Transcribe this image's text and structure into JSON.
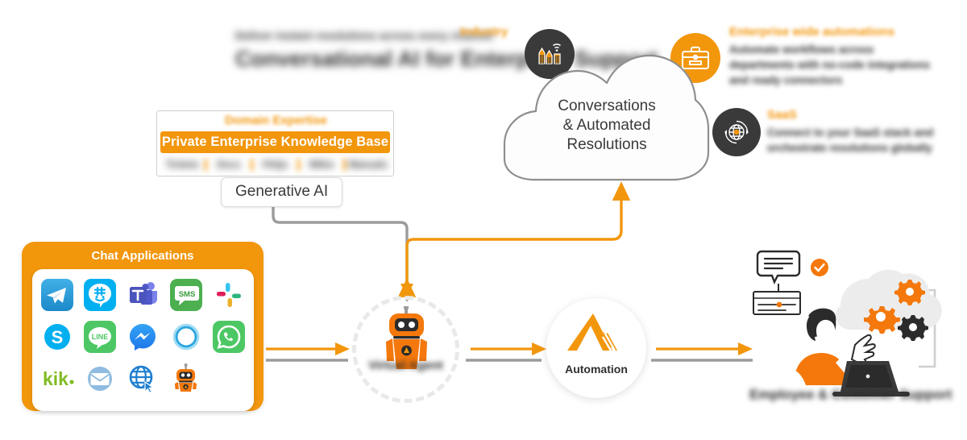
{
  "top_heading": {
    "subtitle": "Deliver instant resolutions across every channel",
    "title": "Conversational AI for Enterprise Support"
  },
  "industry": {
    "label": "Industry",
    "icon": "city-wifi-icon"
  },
  "enterprise": {
    "label": "Enterprise wide automations",
    "body": "Automate workflows across departments with no-code integrations and ready connectors",
    "icon": "briefcase-icon"
  },
  "saas": {
    "label": "SaaS",
    "body": "Connect to your SaaS stack and orchestrate resolutions globally",
    "icon": "globe-gear-icon"
  },
  "knowledge_base": {
    "domain_title": "Domain Expertise",
    "bar_label": "Private Enterprise Knowledge Base",
    "sources": [
      "Tickets",
      "Docs",
      "FAQs",
      "Wikis",
      "Manuals"
    ],
    "gen_ai_label": "Generative AI"
  },
  "cloud": {
    "line1": "Conversations",
    "line2": "& Automated",
    "line3": "Resolutions"
  },
  "chat_applications": {
    "title": "Chat Applications",
    "apps": [
      {
        "name": "telegram-icon",
        "label": "Telegram"
      },
      {
        "name": "groupme-icon",
        "label": "GroupMe"
      },
      {
        "name": "microsoft-teams-icon",
        "label": "Microsoft Teams"
      },
      {
        "name": "sms-icon",
        "label": "SMS"
      },
      {
        "name": "slack-icon",
        "label": "Slack"
      },
      {
        "name": "skype-icon",
        "label": "Skype"
      },
      {
        "name": "line-icon",
        "label": "LINE"
      },
      {
        "name": "facebook-messenger-icon",
        "label": "Messenger"
      },
      {
        "name": "cortana-icon",
        "label": "Cortana"
      },
      {
        "name": "whatsapp-icon",
        "label": "WhatsApp"
      },
      {
        "name": "kik-icon",
        "label": "Kik"
      },
      {
        "name": "email-icon",
        "label": "Email"
      },
      {
        "name": "web-icon",
        "label": "Web"
      },
      {
        "name": "bot-icon",
        "label": "Bot"
      }
    ]
  },
  "bot_node": {
    "label": "Virtual Agent"
  },
  "automation_node": {
    "label": "Automation"
  },
  "illustration": {
    "caption": "Employee & Customer Support"
  },
  "colors": {
    "orange": "#F2960C",
    "orange_deep": "#F4780B",
    "dark": "#2b2b2b",
    "gray_line": "#9b9b9b",
    "panel_white": "#ffffff"
  }
}
